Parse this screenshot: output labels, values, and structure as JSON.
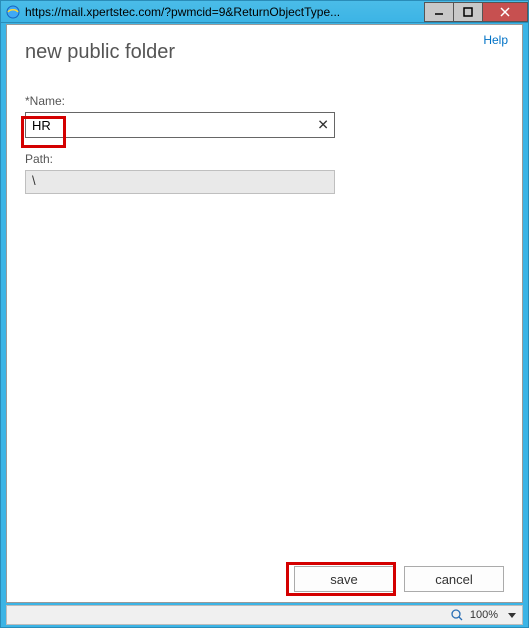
{
  "window": {
    "url": "https://mail.xpertstec.com/?pwmcid=9&ReturnObjectType..."
  },
  "header": {
    "help_label": "Help",
    "title": "new public folder"
  },
  "form": {
    "name_label": "*Name:",
    "name_value": "HR",
    "path_label": "Path:",
    "path_value": "\\"
  },
  "buttons": {
    "save": "save",
    "cancel": "cancel"
  },
  "statusbar": {
    "zoom_text": "100%"
  }
}
